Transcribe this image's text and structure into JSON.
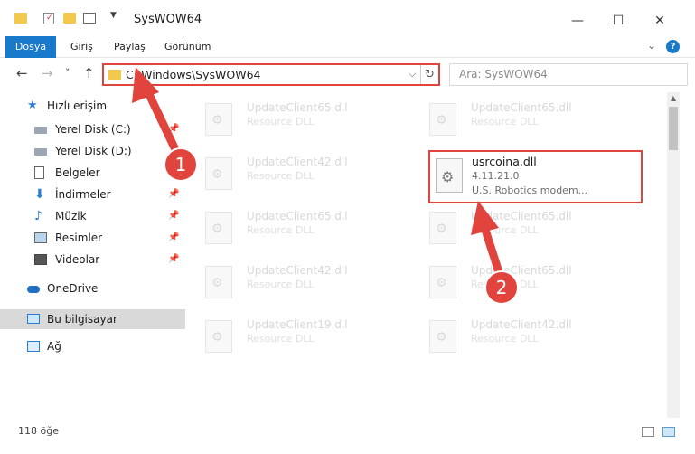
{
  "window": {
    "title": "SysWOW64",
    "minimize": "—",
    "maximize": "☐",
    "close": "✕"
  },
  "ribbon": {
    "tabs": [
      "Dosya",
      "Giriş",
      "Paylaş",
      "Görünüm"
    ],
    "help": "?"
  },
  "navigation": {
    "back": "←",
    "forward": "→",
    "recent": "˅",
    "up": "↑",
    "address": "C:\\Windows\\SysWOW64",
    "search_placeholder": "Ara: SysWOW64"
  },
  "sidebar": {
    "quick_access": "Hızlı erişim",
    "items": [
      {
        "label": "Yerel Disk (C:)",
        "icon": "drive-icon",
        "pinned": true
      },
      {
        "label": "Yerel Disk (D:)",
        "icon": "drive-icon",
        "pinned": false
      },
      {
        "label": "Belgeler",
        "icon": "documents-icon",
        "pinned": true
      },
      {
        "label": "İndirmeler",
        "icon": "downloads-icon",
        "pinned": true
      },
      {
        "label": "Müzik",
        "icon": "music-icon",
        "pinned": true
      },
      {
        "label": "Resimler",
        "icon": "pictures-icon",
        "pinned": true
      },
      {
        "label": "Videolar",
        "icon": "videos-icon",
        "pinned": true
      }
    ],
    "onedrive": "OneDrive",
    "this_pc": "Bu bilgisayar",
    "network": "Ağ"
  },
  "files": {
    "left_column": [
      {
        "name": "UpdateClient65.dll",
        "type": "Resource DLL"
      },
      {
        "name": "UpdateClient42.dll",
        "type": "Resource DLL"
      },
      {
        "name": "UpdateClient65.dll",
        "type": "Resource DLL"
      },
      {
        "name": "UpdateClient42.dll",
        "type": "Resource DLL"
      },
      {
        "name": "UpdateClient19.dll",
        "type": "Resource DLL"
      }
    ],
    "right_column": [
      {
        "name": "UpdateClient65.dll",
        "type": "Resource DLL"
      },
      {
        "name": "UpdateClient65.dll",
        "type": "Resource DLL"
      },
      {
        "name": "UpdateClient65.dll",
        "type": "Resource DLL"
      },
      {
        "name": "UpdateClient42.dll",
        "type": "Resource DLL"
      }
    ],
    "highlighted": {
      "name": "usrcoina.dll",
      "version": "4.11.21.0",
      "description": "U.S. Robotics modem..."
    }
  },
  "status": {
    "item_count": "118 öğe"
  },
  "annotations": {
    "step1": "1",
    "step2": "2",
    "color": "#e0443d"
  }
}
